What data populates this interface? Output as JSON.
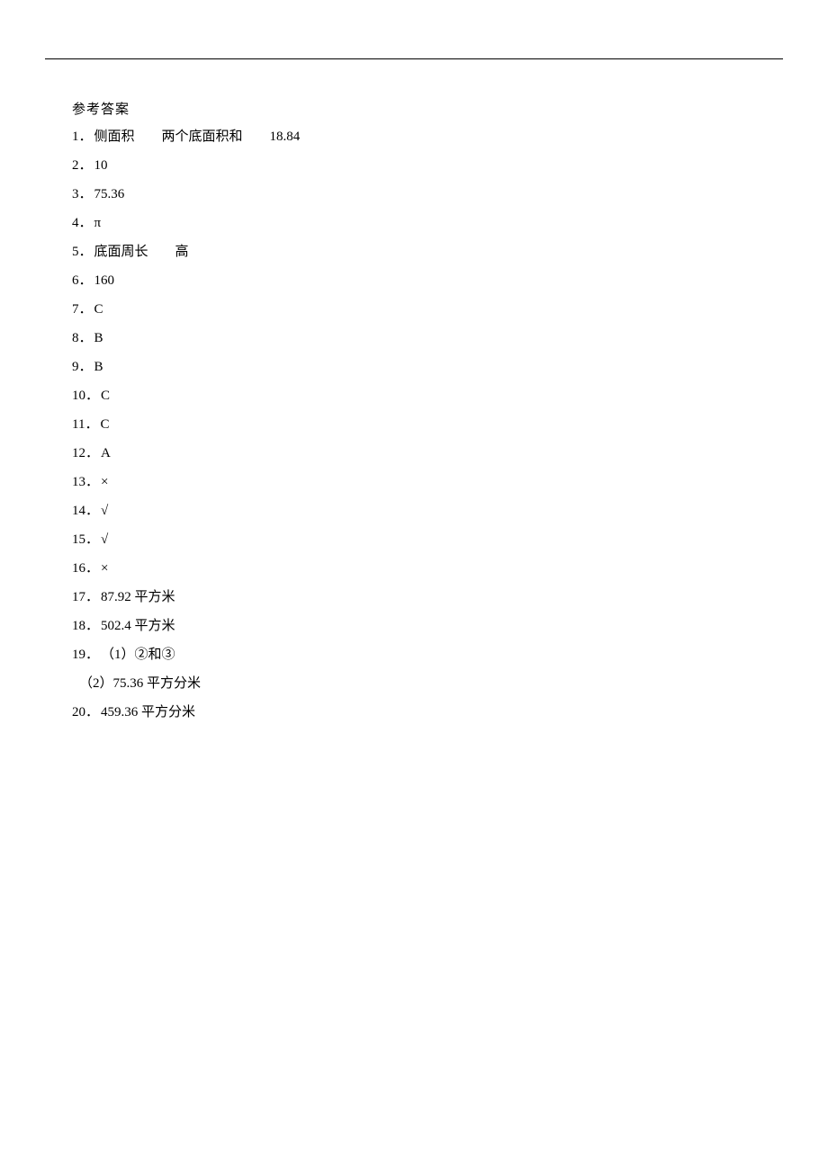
{
  "title": "参考答案",
  "answers": {
    "a1": {
      "num": "1",
      "parts": [
        "侧面积",
        "两个底面积和",
        "18.84"
      ]
    },
    "a2": {
      "num": "2",
      "val": "10"
    },
    "a3": {
      "num": "3",
      "val": "75.36"
    },
    "a4": {
      "num": "4",
      "val": "π"
    },
    "a5": {
      "num": "5",
      "parts": [
        "底面周长",
        "高"
      ]
    },
    "a6": {
      "num": "6",
      "val": "160"
    },
    "a7": {
      "num": "7",
      "val": "C"
    },
    "a8": {
      "num": "8",
      "val": "B"
    },
    "a9": {
      "num": "9",
      "val": "B"
    },
    "a10": {
      "num": "10",
      "val": "C"
    },
    "a11": {
      "num": "11",
      "val": "C"
    },
    "a12": {
      "num": "12",
      "val": "A"
    },
    "a13": {
      "num": "13",
      "val": "×"
    },
    "a14": {
      "num": "14",
      "val": "√"
    },
    "a15": {
      "num": "15",
      "val": "√"
    },
    "a16": {
      "num": "16",
      "val": "×"
    },
    "a17": {
      "num": "17",
      "val": "87.92 平方米"
    },
    "a18": {
      "num": "18",
      "val": "502.4 平方米"
    },
    "a19": {
      "num": "19",
      "sub1_label": "（1）",
      "sub1_val": "②和③",
      "sub2_label": "（2）",
      "sub2_val": "75.36 平方分米"
    },
    "a20": {
      "num": "20",
      "val": "459.36 平方分米"
    }
  }
}
